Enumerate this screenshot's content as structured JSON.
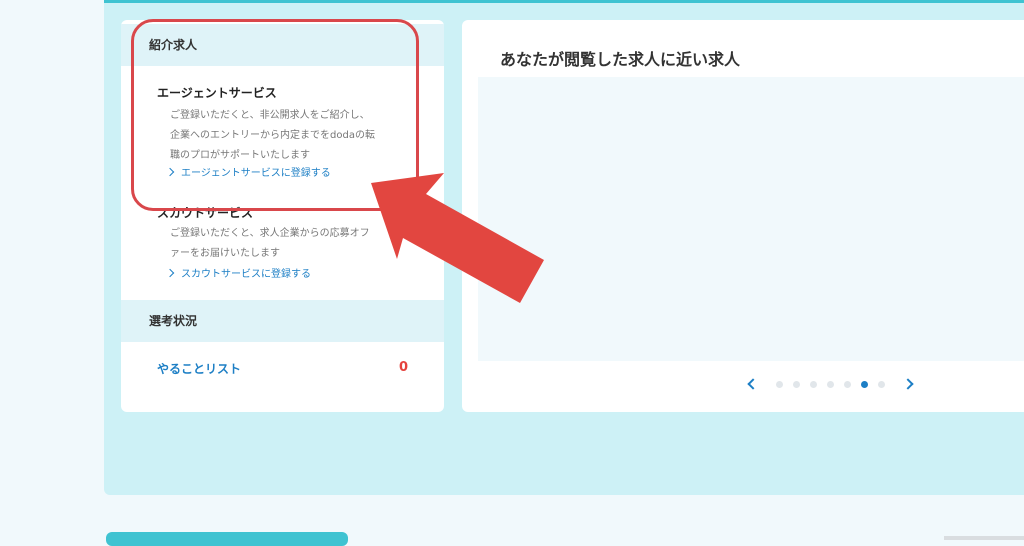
{
  "sidebar": {
    "intro_header": "紹介求人",
    "agent": {
      "title": "エージェントサービス",
      "description_lines": [
        "ご登録いただくと、非公開求人をご紹介し、",
        "企業へのエントリーから内定までをdodaの転",
        "職のプロがサポートいたします"
      ],
      "link_label": "エージェントサービスに登録する"
    },
    "scout": {
      "title": "スカウトサービス",
      "description_lines": [
        "ご登録いただくと、求人企業からの応募オフ",
        "ァーをお届けいたします"
      ],
      "link_label": "スカウトサービスに登録する"
    },
    "selection_header": "選考状況",
    "todo": {
      "label": "やることリスト",
      "count": "0"
    }
  },
  "main": {
    "title": "あなたが閲覧した求人に近い求人",
    "carousel": {
      "dot_count": 7,
      "active_index": 5
    }
  },
  "colors": {
    "accent": "#1d7fc5",
    "alert": "#e5423d",
    "highlight": "#d9474b",
    "panel_bg": "#cdf1f6",
    "section_head": "#dff3f8"
  }
}
